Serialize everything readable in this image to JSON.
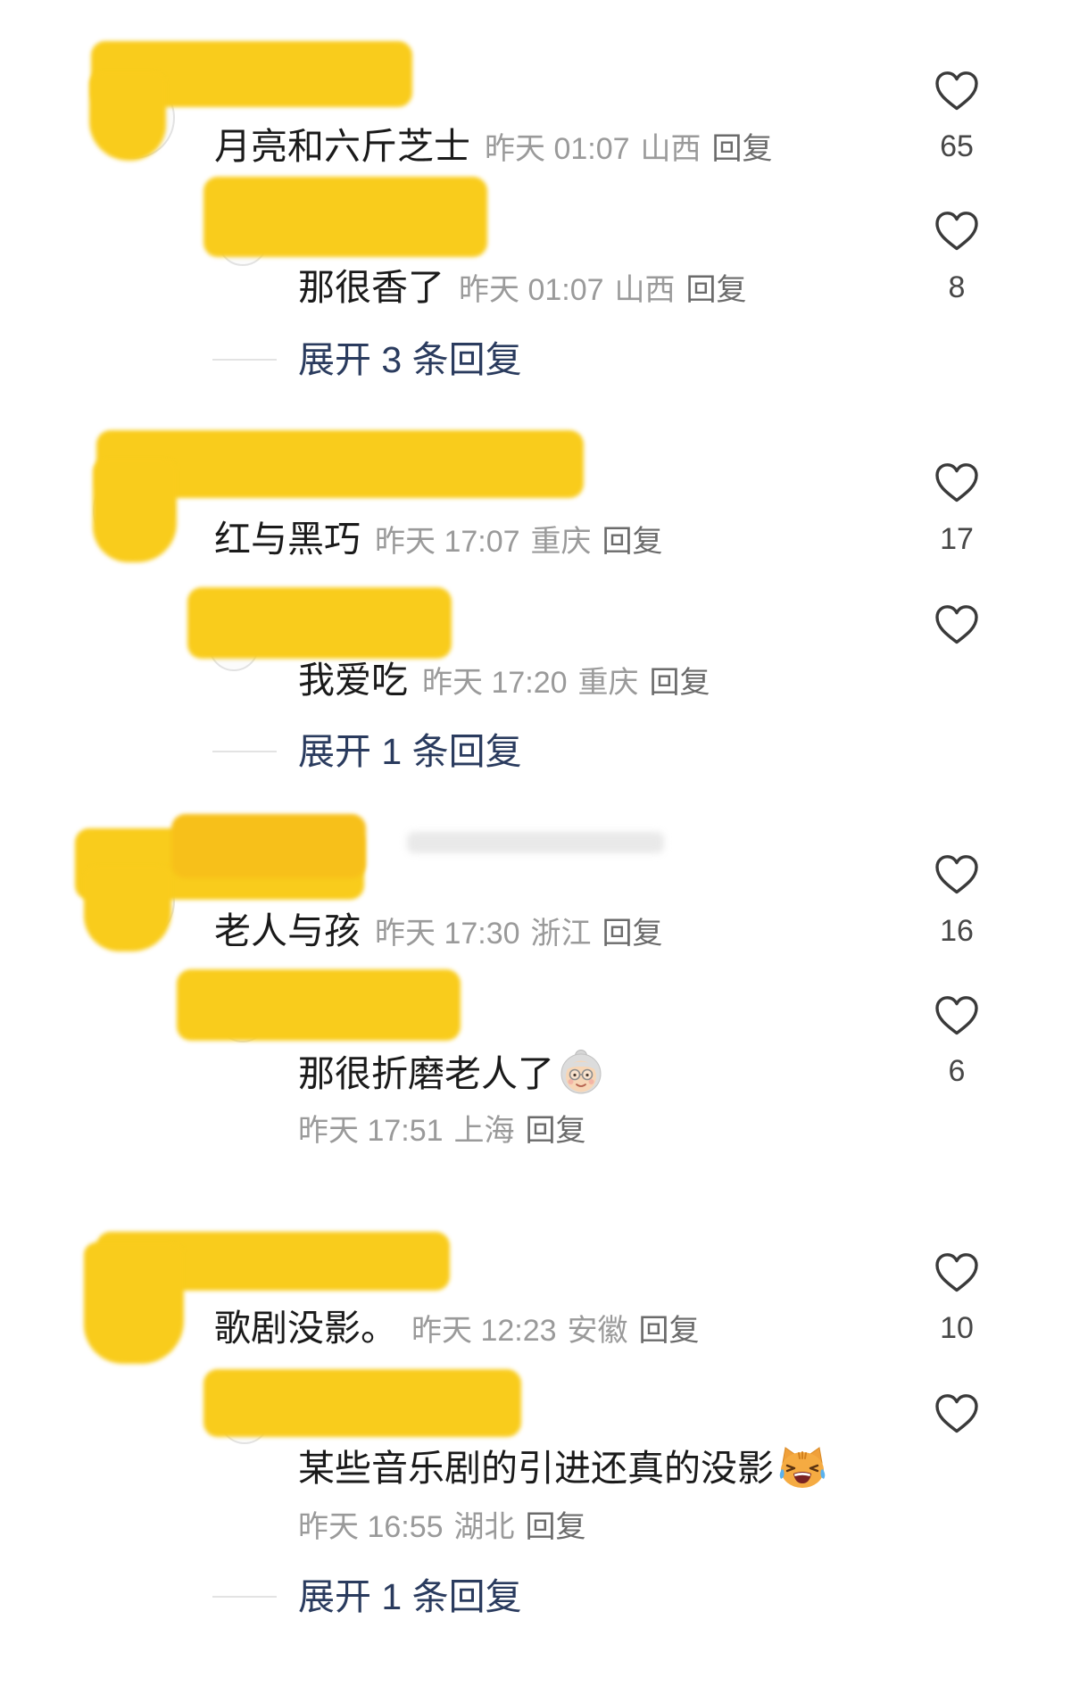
{
  "colors": {
    "background": "#ffffff",
    "text": "#1a1a1a",
    "meta": "#9a9a9a",
    "reply_action": "#6b6b6b",
    "expand": "#2a3b5e",
    "like_icon": "#3a3a3a",
    "like_count": "#474747",
    "redaction": "#f9cc1c"
  },
  "icons": {
    "like": "heart-outline-icon"
  },
  "comments": [
    {
      "text": "月亮和六斤芝士",
      "time": "昨天 01:07",
      "location": "山西",
      "reply_action": "回复",
      "likes": "65",
      "replies": [
        {
          "text": "那很香了",
          "time": "昨天 01:07",
          "location": "山西",
          "reply_action": "回复",
          "likes": "8"
        }
      ],
      "expand_label": "展开 3 条回复"
    },
    {
      "text": "红与黑巧",
      "time": "昨天 17:07",
      "location": "重庆",
      "reply_action": "回复",
      "likes": "17",
      "replies": [
        {
          "text": "我爱吃",
          "time": "昨天 17:20",
          "location": "重庆",
          "reply_action": "回复"
        }
      ],
      "expand_label": "展开 1 条回复"
    },
    {
      "text": "老人与孩",
      "time": "昨天 17:30",
      "location": "浙江",
      "reply_action": "回复",
      "likes": "16",
      "replies": [
        {
          "text": "那很折磨老人了",
          "emoji": "older-woman-emoji",
          "time": "昨天 17:51",
          "location": "上海",
          "reply_action": "回复",
          "likes": "6"
        }
      ]
    },
    {
      "text": "歌剧没影。",
      "time": "昨天 12:23",
      "location": "安徽",
      "reply_action": "回复",
      "likes": "10",
      "replies": [
        {
          "text": "某些音乐剧的引进还真的没影",
          "emoji": "cat-with-tears-of-joy-emoji",
          "time": "昨天 16:55",
          "location": "湖北",
          "reply_action": "回复"
        }
      ],
      "expand_label": "展开 1 条回复"
    }
  ]
}
